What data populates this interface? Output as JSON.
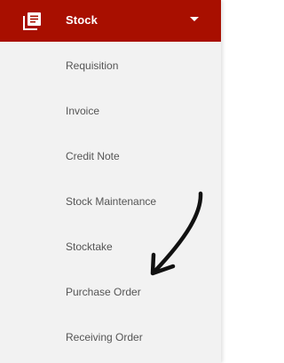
{
  "header": {
    "icon": "library-books-icon",
    "title": "Stock",
    "expand_icon": "caret-down-icon",
    "background_color": "#a80f00"
  },
  "menu": {
    "items": [
      {
        "label": "Requisition"
      },
      {
        "label": "Invoice"
      },
      {
        "label": "Credit Note"
      },
      {
        "label": "Stock Maintenance"
      },
      {
        "label": "Stocktake"
      },
      {
        "label": "Purchase Order"
      },
      {
        "label": "Receiving Order"
      }
    ]
  },
  "annotation": {
    "icon": "hand-drawn-arrow",
    "color": "#111111"
  }
}
